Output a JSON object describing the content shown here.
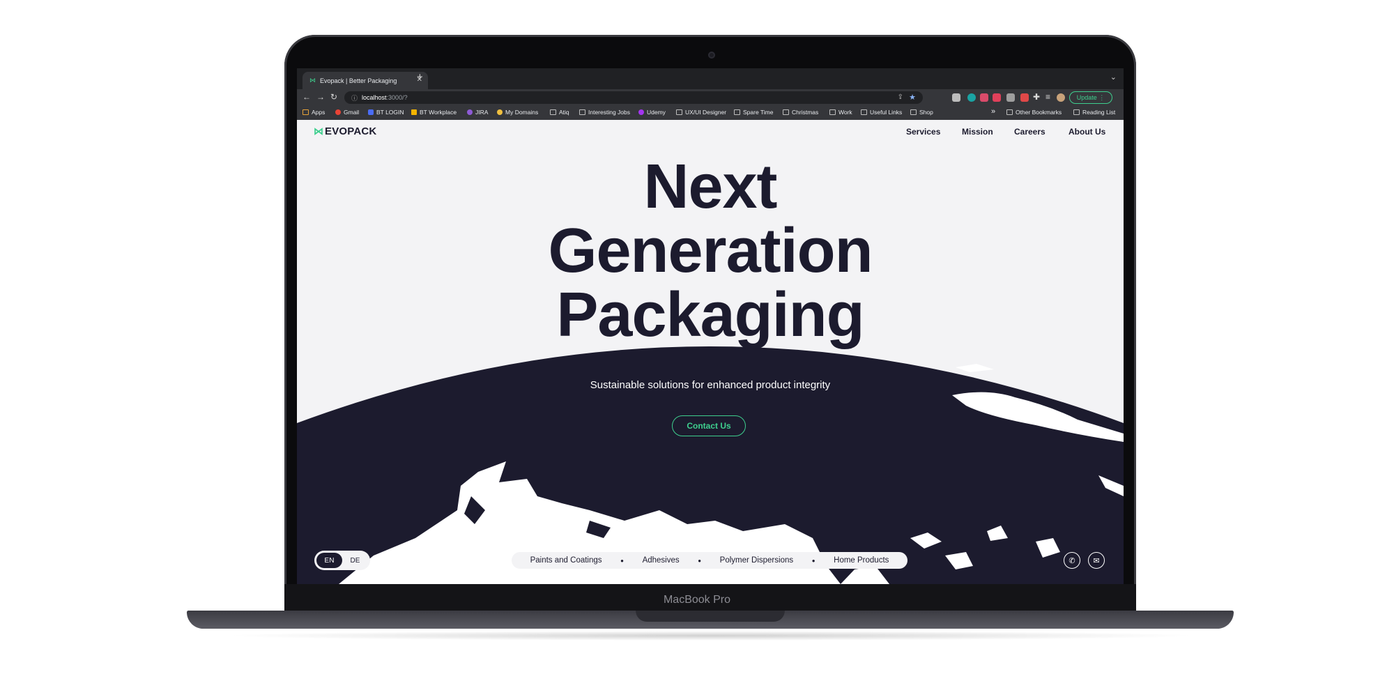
{
  "device": {
    "label": "MacBook Pro"
  },
  "browser": {
    "tab_title": "Evopack | Better Packaging",
    "url_host": "localhost",
    "url_path": ":3000/?",
    "update_label": "Update",
    "bookmarks": [
      "Apps",
      "Gmail",
      "BT LOGIN",
      "BT Workplace",
      "JIRA",
      "My Domains",
      "Atiq",
      "Interesting Jobs",
      "Udemy",
      "UX/UI Designer",
      "Spare Time",
      "Christmas",
      "Work",
      "Useful Links",
      "Shop"
    ],
    "bookmarks_more": "»",
    "other_bookmarks": "Other Bookmarks",
    "reading_list": "Reading List"
  },
  "site": {
    "logo_text": "EVOPACK",
    "nav": [
      "Services",
      "Mission",
      "Careers",
      "About Us"
    ],
    "hero_lines": [
      "Next",
      "Generation",
      "Packaging"
    ],
    "subtitle": "Sustainable solutions for enhanced product integrity",
    "cta": "Contact Us",
    "languages": {
      "active": "EN",
      "inactive": "DE"
    },
    "categories": [
      "Paints and Coatings",
      "Adhesives",
      "Polymer Dispersions",
      "Home Products"
    ]
  },
  "colors": {
    "accent": "#3ecf8e",
    "navy": "#1c1b2e",
    "page_bg": "#f3f3f5"
  },
  "icons": [
    "phone-icon",
    "mail-icon",
    "logo-mark-icon"
  ]
}
